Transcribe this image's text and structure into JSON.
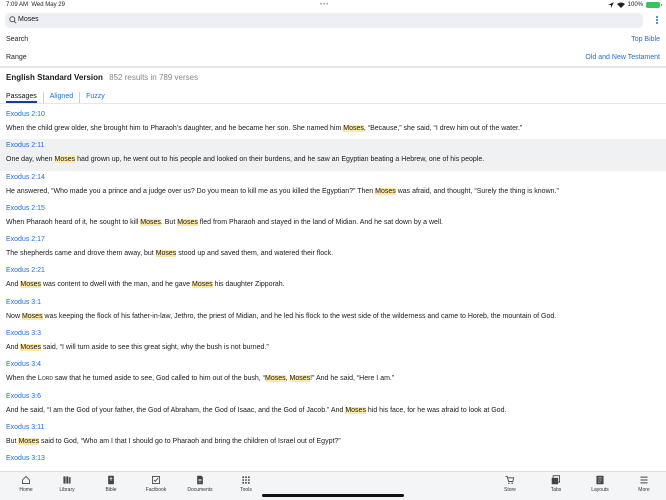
{
  "status": {
    "time": "7:09 AM",
    "date": "Wed May 29",
    "center": "•••",
    "battery": "100%"
  },
  "search": {
    "query": "Moses"
  },
  "options": [
    {
      "label": "Search",
      "value": "Top Bible"
    },
    {
      "label": "Range",
      "value": "Old and New Testament"
    }
  ],
  "summary": {
    "version": "English Standard Version",
    "count": "852 results in 789 verses"
  },
  "tabs": [
    "Passages",
    "Aligned",
    "Fuzzy"
  ],
  "results": [
    {
      "ref": "Exodus 2:10",
      "segments": [
        {
          "t": "When the child grew older, she brought him to Pharaoh’s daughter, and he became her son. She named him "
        },
        {
          "t": "Moses",
          "hl": true
        },
        {
          "t": ", “Because,” she said, “I drew him out of the water.”"
        }
      ]
    },
    {
      "ref": "Exodus 2:11",
      "selected": true,
      "segments": [
        {
          "t": "One day, when "
        },
        {
          "t": "Moses",
          "hl": true
        },
        {
          "t": " had grown up, he went out to his people and looked on their burdens, and he saw an Egyptian beating a Hebrew, one of his people."
        }
      ]
    },
    {
      "ref": "Exodus 2:14",
      "segments": [
        {
          "t": "He answered, “Who made you a prince and a judge over us? Do you mean to kill me as you killed the Egyptian?” Then "
        },
        {
          "t": "Moses",
          "hl": true
        },
        {
          "t": " was afraid, and thought, “Surely the thing is known.”"
        }
      ]
    },
    {
      "ref": "Exodus 2:15",
      "segments": [
        {
          "t": "When Pharaoh heard of it, he sought to kill "
        },
        {
          "t": "Moses",
          "hl": true
        },
        {
          "t": ". But "
        },
        {
          "t": "Moses",
          "hl": true
        },
        {
          "t": " fled from Pharaoh and stayed in the land of Midian. And he sat down by a well."
        }
      ]
    },
    {
      "ref": "Exodus 2:17",
      "segments": [
        {
          "t": "The shepherds came and drove them away, but "
        },
        {
          "t": "Moses",
          "hl": true
        },
        {
          "t": " stood up and saved them, and watered their flock."
        }
      ]
    },
    {
      "ref": "Exodus 2:21",
      "segments": [
        {
          "t": "And "
        },
        {
          "t": "Moses",
          "hl": true
        },
        {
          "t": " was content to dwell with the man, and he gave "
        },
        {
          "t": "Moses",
          "hl": true
        },
        {
          "t": " his daughter Zipporah."
        }
      ]
    },
    {
      "ref": "Exodus 3:1",
      "segments": [
        {
          "t": "Now "
        },
        {
          "t": "Moses",
          "hl": true
        },
        {
          "t": " was keeping the flock of his father-in-law, Jethro, the priest of Midian, and he led his flock to the west side of the wilderness and came to Horeb, the mountain of God."
        }
      ]
    },
    {
      "ref": "Exodus 3:3",
      "segments": [
        {
          "t": "And "
        },
        {
          "t": "Moses",
          "hl": true
        },
        {
          "t": " said, “I will turn aside to see this great sight, why the bush is not burned.”"
        }
      ]
    },
    {
      "ref": "Exodus 3:4",
      "segments": [
        {
          "t": "When the "
        },
        {
          "t": "Lord",
          "sc": true
        },
        {
          "t": " saw that he turned aside to see, God called to him out of the bush, “"
        },
        {
          "t": "Moses",
          "hl": true
        },
        {
          "t": ", "
        },
        {
          "t": "Moses",
          "hl": true
        },
        {
          "t": "!” And he said, “Here I am.”"
        }
      ]
    },
    {
      "ref": "Exodus 3:6",
      "segments": [
        {
          "t": "And he said, “I am the God of your father, the God of Abraham, the God of Isaac, and the God of Jacob.” And "
        },
        {
          "t": "Moses",
          "hl": true
        },
        {
          "t": " hid his face, for he was afraid to look at God."
        }
      ]
    },
    {
      "ref": "Exodus 3:11",
      "segments": [
        {
          "t": "But "
        },
        {
          "t": "Moses",
          "hl": true
        },
        {
          "t": " said to God, “Who am I that I should go to Pharaoh and bring the children of Israel out of Egypt?”"
        }
      ]
    },
    {
      "ref": "Exodus 3:13",
      "segments": []
    }
  ],
  "tabbar": [
    {
      "label": "Home",
      "icon": "home-icon"
    },
    {
      "label": "Library",
      "icon": "library-icon"
    },
    {
      "label": "Bible",
      "icon": "bible-icon"
    },
    {
      "label": "Factbook",
      "icon": "factbook-icon"
    },
    {
      "label": "Documents",
      "icon": "documents-icon"
    },
    {
      "label": "Tools",
      "icon": "tools-icon"
    },
    {
      "label": "Store",
      "icon": "store-icon"
    },
    {
      "label": "Tabs",
      "icon": "tabs-icon"
    },
    {
      "label": "Layouts",
      "icon": "layouts-icon"
    },
    {
      "label": "More",
      "icon": "more-icon"
    }
  ],
  "colors": {
    "accent": "#1d6fd6",
    "highlight": "#fde8a8",
    "selected_row": "#f0f1f3"
  }
}
